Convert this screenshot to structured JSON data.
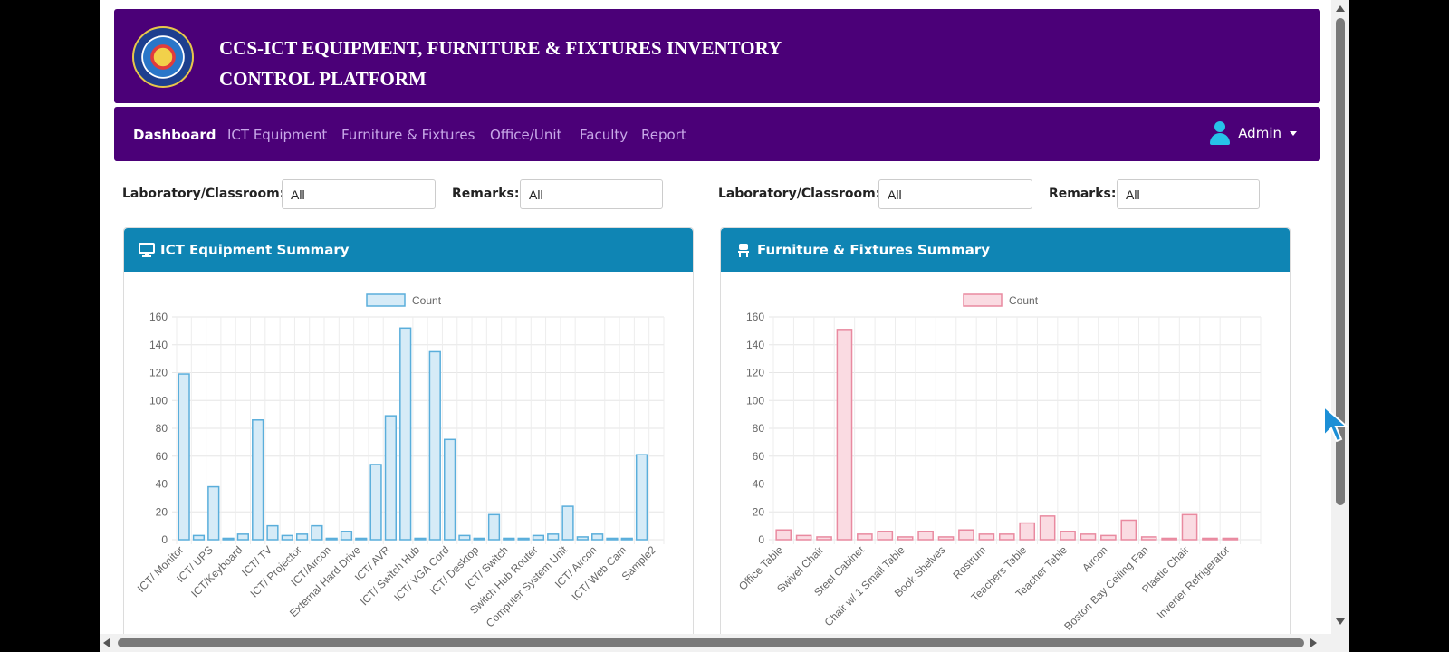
{
  "banner": {
    "title_line1": "CCS-ICT EQUIPMENT, FURNITURE & FIXTURES INVENTORY",
    "title_line2": "CONTROL PLATFORM"
  },
  "nav": {
    "items": [
      "Dashboard",
      "ICT Equipment",
      "Furniture & Fixtures",
      "Office/Unit",
      "Faculty",
      "Report"
    ],
    "active": "Dashboard",
    "user_label": "Admin"
  },
  "filters": {
    "ict": {
      "lab_label": "Laboratory/Classroom:",
      "lab_value": "All",
      "remarks_label": "Remarks:",
      "remarks_value": "All"
    },
    "furniture": {
      "lab_label": "Laboratory/Classroom:",
      "lab_value": "All",
      "remarks_label": "Remarks:",
      "remarks_value": "All"
    }
  },
  "cards": {
    "ict_title": "ICT Equipment Summary",
    "furniture_title": "Furniture & Fixtures Summary"
  },
  "colors": {
    "brand_purple": "#4b0078",
    "header_blue": "#0f85b4",
    "ict_bar_fill": "#d6ebf7",
    "ict_bar_stroke": "#5aaedb",
    "furn_bar_fill": "#fadbe2",
    "furn_bar_stroke": "#e98aa0"
  },
  "icons": {
    "logo": "college-seal-logo",
    "user": "user-icon",
    "ict_header": "monitor-icon",
    "furniture_header": "chair-icon"
  },
  "chart_data": [
    {
      "type": "bar",
      "legend": "Count",
      "ylim": [
        0,
        160
      ],
      "yticks": [
        0,
        20,
        40,
        60,
        80,
        100,
        120,
        140,
        160
      ],
      "grid": true,
      "legend_position": "top",
      "categories": [
        "ICT/ Monitor",
        "",
        "ICT/ UPS",
        "",
        "ICT/Keyboard",
        "",
        "ICT/ TV",
        "",
        "ICT/ Projector",
        "",
        "ICT/Aircon",
        "",
        "External Hard Drive",
        "",
        "ICT/ AVR",
        "",
        "ICT/ Switch Hub",
        "",
        "ICT/ VGA Cord",
        "",
        "ICT/ Desktop",
        "",
        "ICT/ Switch",
        "",
        "Switch Hub Router",
        "",
        "Computer System Unit",
        "",
        "ICT/ Aircon",
        "",
        "ICT/ Web Cam",
        "",
        "Sample2"
      ],
      "values": [
        119,
        3,
        38,
        1,
        4,
        86,
        10,
        3,
        4,
        10,
        1,
        6,
        1,
        54,
        89,
        152,
        1,
        135,
        72,
        3,
        1,
        18,
        1,
        1,
        3,
        4,
        24,
        2,
        4,
        1,
        1,
        61,
        0
      ]
    },
    {
      "type": "bar",
      "legend": "Count",
      "ylim": [
        0,
        160
      ],
      "yticks": [
        0,
        20,
        40,
        60,
        80,
        100,
        120,
        140,
        160
      ],
      "grid": true,
      "legend_position": "top",
      "categories": [
        "Office Table",
        "",
        "Swivel Chair",
        "",
        "Steel Cabinet",
        "",
        "Chair w/ 1 Small Table",
        "",
        "Book Shelves",
        "",
        "Rostrum",
        "",
        "Teachers Table",
        "",
        "Teacher Table",
        "",
        "Aircon",
        "",
        "Boston Bay Ceiling Fan",
        "",
        "Plastic Chair",
        "",
        "Inverter Refrigerator",
        ""
      ],
      "values": [
        7,
        3,
        2,
        151,
        4,
        6,
        2,
        6,
        2,
        7,
        4,
        4,
        12,
        17,
        6,
        4,
        3,
        14,
        2,
        1,
        18,
        1,
        1,
        0
      ]
    }
  ]
}
